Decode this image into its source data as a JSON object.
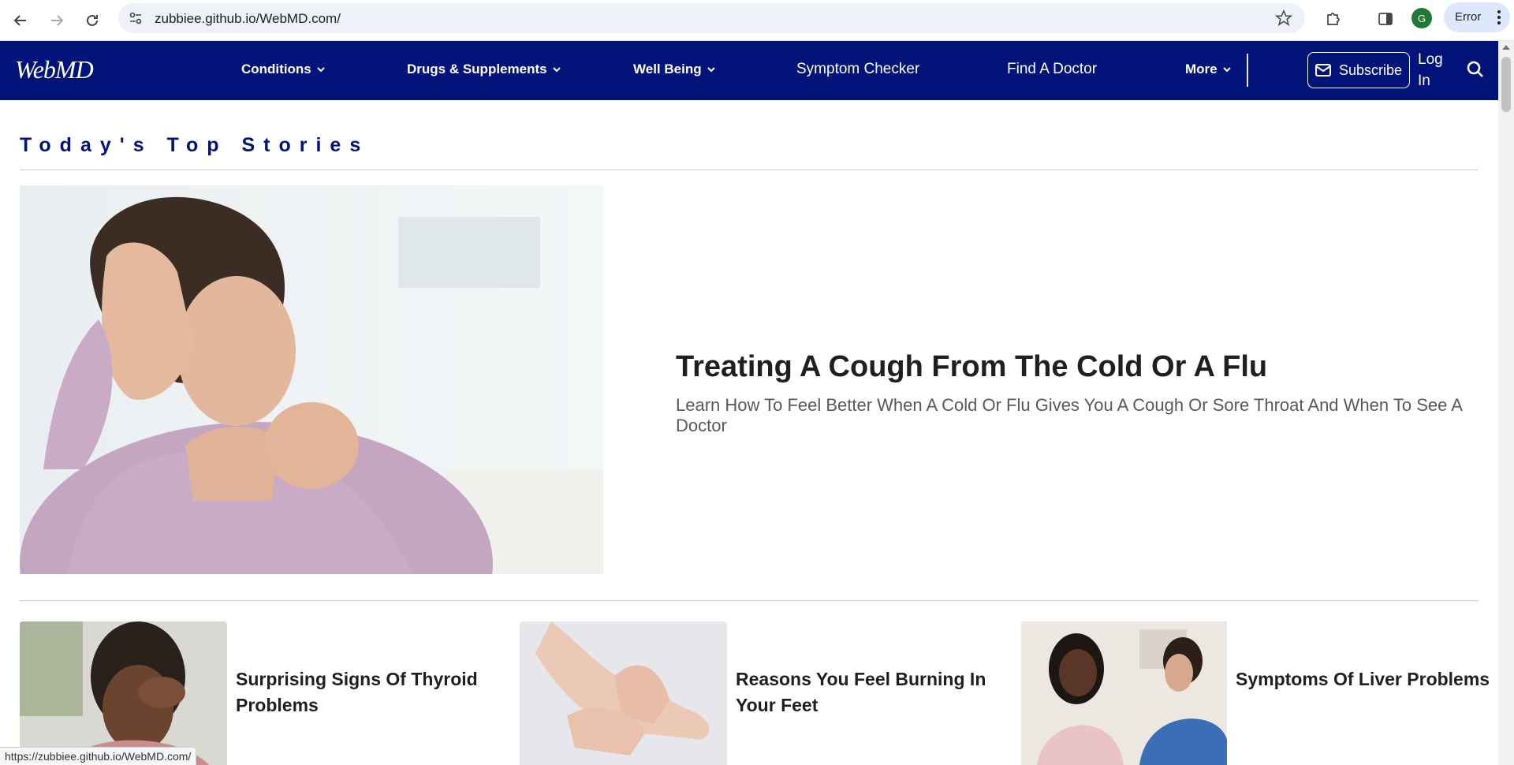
{
  "browser": {
    "url": "zubbiee.github.io/WebMD.com/",
    "profile_initial": "G",
    "error_label": "Error",
    "status_url": "https://zubbiee.github.io/WebMD.com/"
  },
  "header": {
    "logo": "WebMD",
    "nav": {
      "conditions": "Conditions",
      "drugs": "Drugs & Supplements",
      "wellbeing": "Well Being",
      "symptom_checker": "Symptom Checker",
      "find_doctor": "Find A Doctor",
      "more": "More"
    },
    "subscribe": "Subscribe",
    "login": "Log In"
  },
  "main": {
    "section_title": "Today's Top Stories",
    "hero": {
      "title": "Treating A Cough From The Cold Or A Flu",
      "subtitle": "Learn How To Feel Better When A Cold Or Flu Gives You A Cough Or Sore Throat And When To See A Doctor"
    },
    "cards": [
      {
        "title": "Surprising Signs Of Thyroid Problems"
      },
      {
        "title": "Reasons You Feel Burning In Your Feet"
      },
      {
        "title": "Symptoms Of Liver Problems"
      }
    ]
  },
  "colors": {
    "brand_navy": "#021379",
    "text_dark": "#1f1f1f",
    "text_gray": "#595959"
  }
}
